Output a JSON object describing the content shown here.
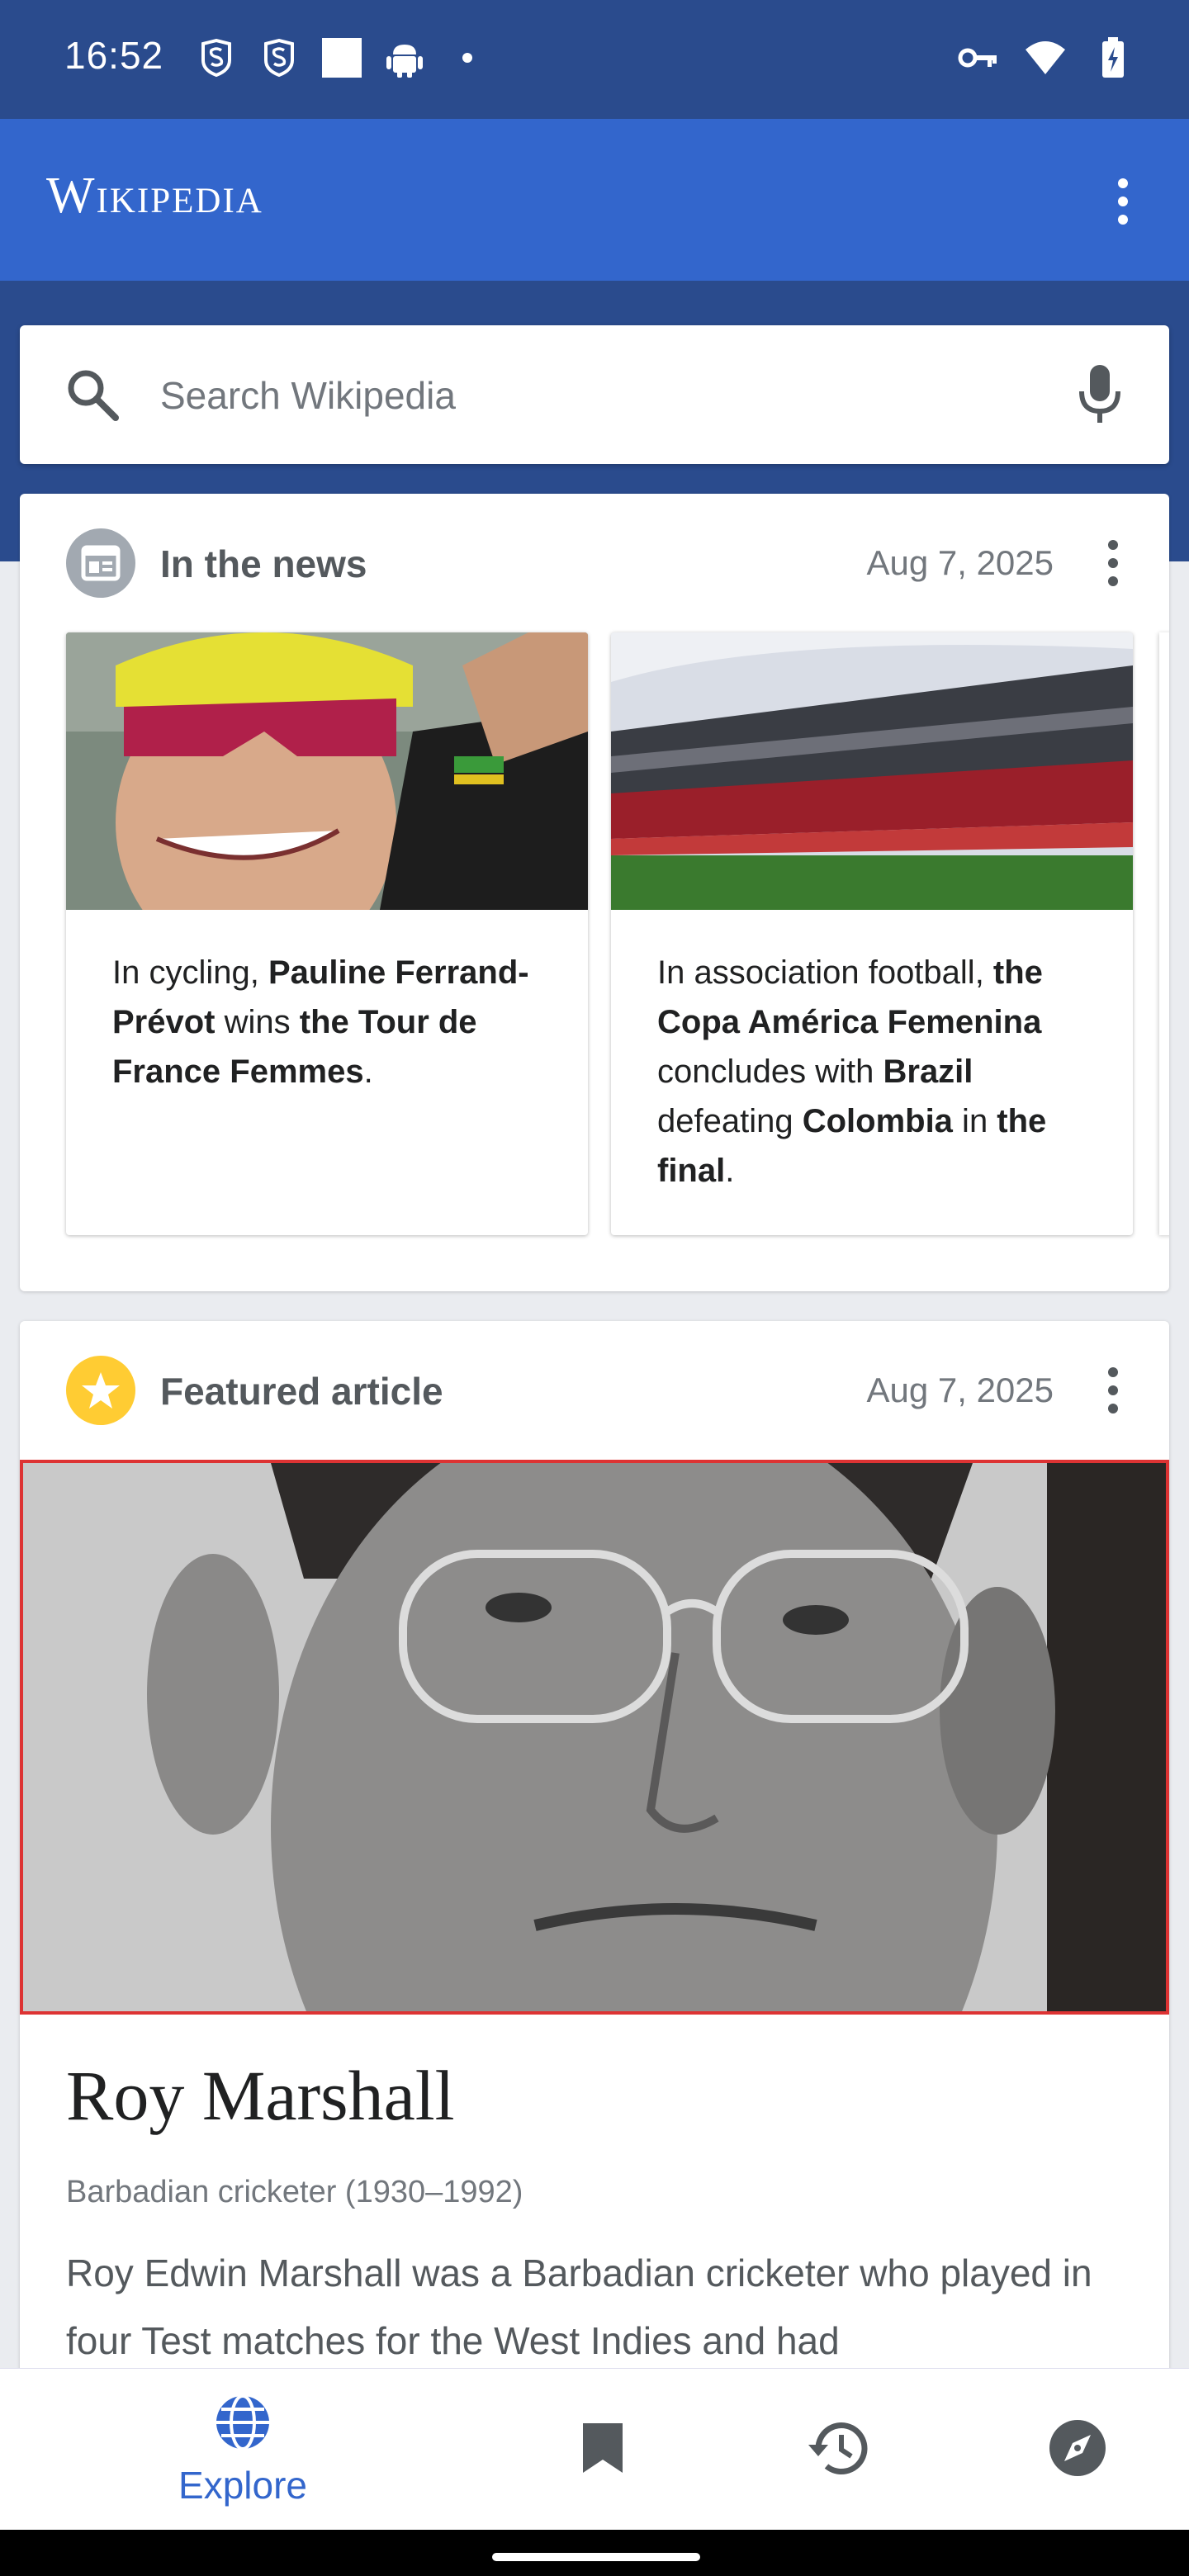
{
  "status_bar": {
    "time": "16:52",
    "left_icons": [
      "shield-s-icon",
      "shield-s-icon",
      "square-icon",
      "android-icon",
      "dot-icon"
    ],
    "right_icons": [
      "vpn-key-icon",
      "wifi-icon",
      "battery-icon"
    ]
  },
  "app_bar": {
    "logo": "Wikipedia",
    "menu_icon": "more-vert-icon"
  },
  "search": {
    "placeholder": "Search Wikipedia",
    "value": ""
  },
  "news_card": {
    "title": "In the news",
    "date": "Aug 7, 2025",
    "items": [
      {
        "parts": [
          {
            "t": "In cycling, ",
            "b": false
          },
          {
            "t": "Pauline Ferrand-Prévot",
            "b": true
          },
          {
            "t": " wins ",
            "b": false
          },
          {
            "t": "the Tour de France Femmes",
            "b": true
          },
          {
            "t": ".",
            "b": false
          }
        ]
      },
      {
        "parts": [
          {
            "t": "In association football, ",
            "b": false
          },
          {
            "t": "the Copa América Femenina",
            "b": true
          },
          {
            "t": " concludes with ",
            "b": false
          },
          {
            "t": "Brazil",
            "b": true
          },
          {
            "t": " defeating ",
            "b": false
          },
          {
            "t": "Colombia",
            "b": true
          },
          {
            "t": " in ",
            "b": false
          },
          {
            "t": "the final",
            "b": true
          },
          {
            "t": ".",
            "b": false
          }
        ]
      }
    ]
  },
  "featured_card": {
    "title": "Featured article",
    "date": "Aug 7, 2025",
    "article_title": "Roy Marshall",
    "description": "Barbadian cricketer (1930–1992)",
    "extract": "Roy Edwin Marshall was a Barbadian cricketer who played in four Test matches for the West Indies and had"
  },
  "bottom_nav": {
    "explore_label": "Explore",
    "items": [
      "explore-icon",
      "bookmark-icon",
      "history-icon",
      "compass-icon"
    ]
  },
  "colors": {
    "status_bar": "#2a4b8d",
    "app_bar": "#3366cc",
    "accent": "#3366cc",
    "star": "#fc3",
    "selection_border": "#d33"
  }
}
